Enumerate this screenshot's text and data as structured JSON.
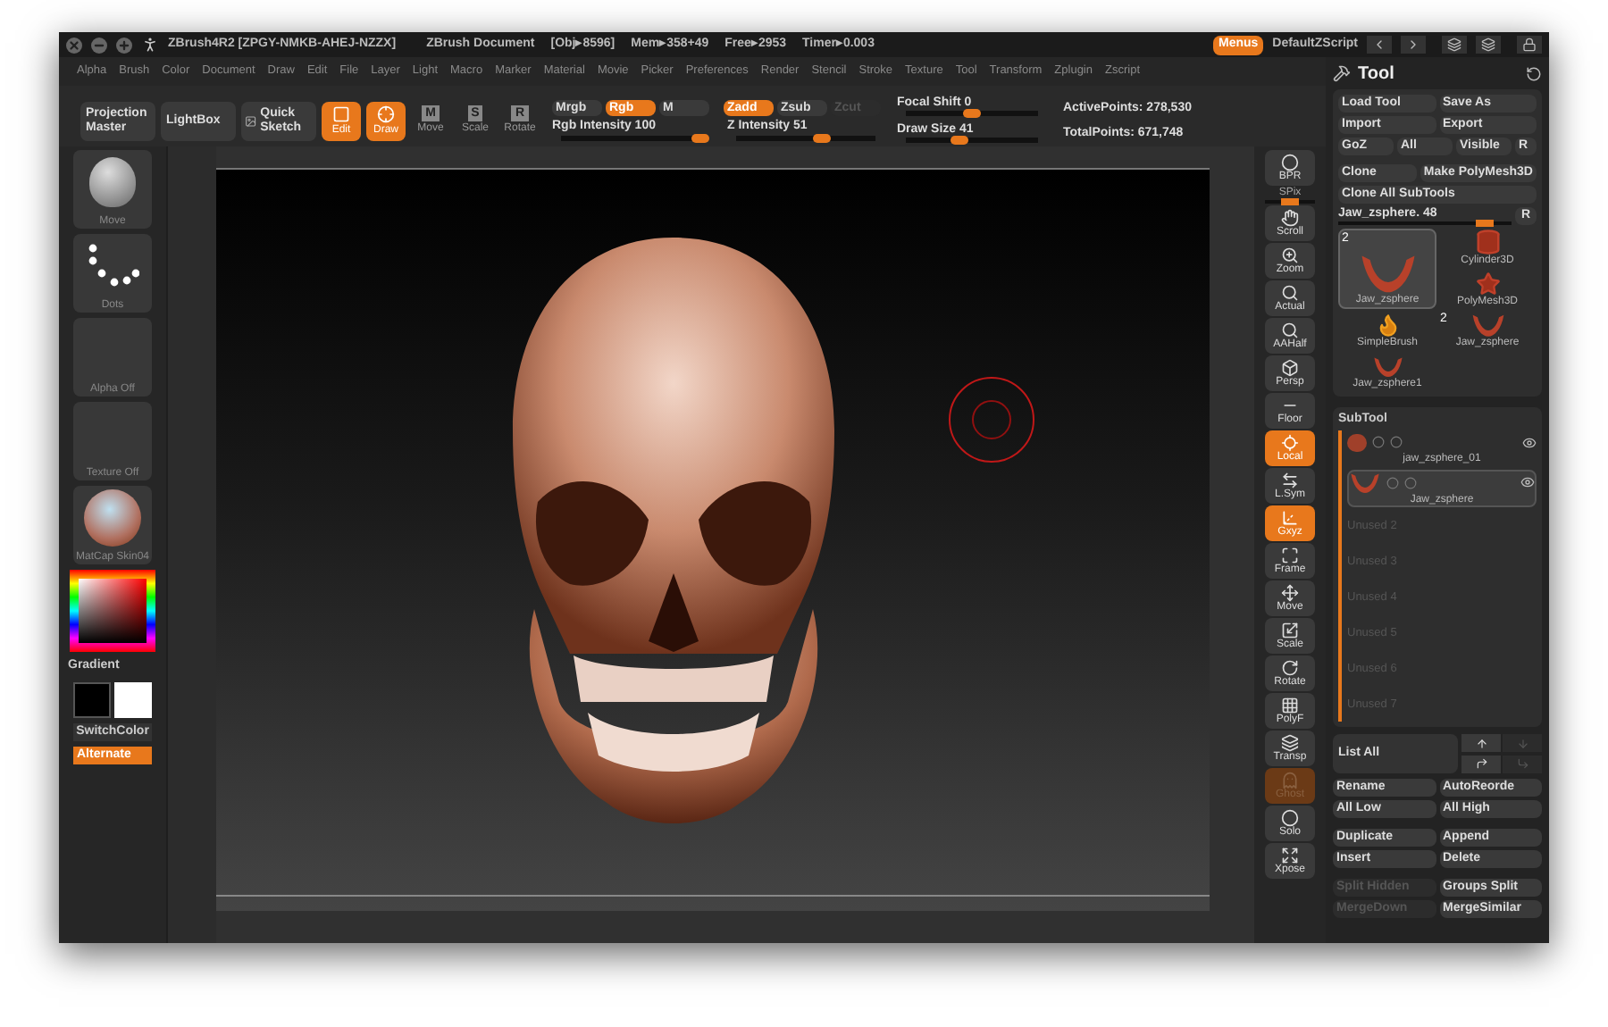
{
  "window": {
    "title": "ZBrush4R2 [ZPGY-NMKB-AHEJ-NZZX]",
    "document": "ZBrush Document",
    "stats": [
      "[Obj▸8596]",
      "Mem▸358+49",
      "Free▸2953",
      "Timer▸0.003"
    ]
  },
  "header_right": {
    "menus": {
      "label": "Menus",
      "on": true
    },
    "script": "DefaultZScript"
  },
  "menu": [
    "Alpha",
    "Brush",
    "Color",
    "Document",
    "Draw",
    "Edit",
    "File",
    "Layer",
    "Light",
    "Macro",
    "Marker",
    "Material",
    "Movie",
    "Picker",
    "Preferences",
    "Render",
    "Stencil",
    "Stroke",
    "Texture",
    "Tool",
    "Transform",
    "Zplugin",
    "Zscript"
  ],
  "toolbar": {
    "projection_master": "Projection Master",
    "lightbox": "LightBox",
    "quick_sketch": "Quick Sketch",
    "modes": [
      {
        "label": "Edit",
        "on": true
      },
      {
        "label": "Draw",
        "on": true
      },
      {
        "label": "Move",
        "key": "M",
        "on": false
      },
      {
        "label": "Scale",
        "key": "S",
        "on": false
      },
      {
        "label": "Rotate",
        "key": "R",
        "on": false
      }
    ],
    "color_modes": [
      {
        "label": "Mrgb",
        "on": false,
        "disabled": false
      },
      {
        "label": "Rgb",
        "on": true,
        "disabled": false
      },
      {
        "label": "M",
        "on": false,
        "disabled": false
      }
    ],
    "z_modes": [
      {
        "label": "Zadd",
        "on": true,
        "disabled": false
      },
      {
        "label": "Zsub",
        "on": false,
        "disabled": false
      },
      {
        "label": "Zcut",
        "on": false,
        "disabled": true
      }
    ],
    "sliders": [
      {
        "label": "Rgb Intensity",
        "value": "100",
        "level": 1.0
      },
      {
        "label": "Z Intensity",
        "value": "51",
        "level": 0.62
      }
    ],
    "right_sliders": [
      {
        "label": "Focal Shift",
        "value": "0",
        "level": 0.5
      },
      {
        "label": "Draw Size",
        "value": "41",
        "level": 0.4
      }
    ],
    "points": [
      "ActivePoints: 278,530",
      "TotalPoints: 671,748"
    ]
  },
  "left_panel": {
    "thumbs": [
      {
        "label": "Move",
        "kind": "brush"
      },
      {
        "label": "Dots",
        "kind": "stroke"
      },
      {
        "label": "Alpha Off",
        "kind": "empty"
      },
      {
        "label": "Texture Off",
        "kind": "empty"
      },
      {
        "label": "MatCap Skin04",
        "kind": "material"
      }
    ],
    "gradient": "Gradient",
    "switch_color": "SwitchColor",
    "alternate": {
      "label": "Alternate",
      "on": true
    }
  },
  "shelf": [
    {
      "label": "BPR",
      "on": false,
      "disabled": false
    },
    {
      "label": "SPix",
      "level": 0.5
    },
    {
      "label": "Scroll",
      "on": false,
      "disabled": false
    },
    {
      "label": "Zoom",
      "on": false,
      "disabled": false
    },
    {
      "label": "Actual",
      "on": false,
      "disabled": false
    },
    {
      "label": "AAHalf",
      "on": false,
      "disabled": false
    },
    {
      "label": "Persp",
      "on": false,
      "disabled": false
    },
    {
      "label": "Floor",
      "on": false,
      "disabled": false
    },
    {
      "label": "Local",
      "on": true,
      "disabled": false
    },
    {
      "label": "L.Sym",
      "on": false,
      "disabled": false
    },
    {
      "label": "Gxyz",
      "on": true,
      "disabled": false
    },
    {
      "label": "Frame",
      "on": false,
      "disabled": false
    },
    {
      "label": "Move",
      "on": false,
      "disabled": false
    },
    {
      "label": "Scale",
      "on": false,
      "disabled": false
    },
    {
      "label": "Rotate",
      "on": false,
      "disabled": false
    },
    {
      "label": "PolyF",
      "on": false,
      "disabled": false
    },
    {
      "label": "Transp",
      "on": false,
      "disabled": false
    },
    {
      "label": "Ghost",
      "on": true,
      "disabled": true
    },
    {
      "label": "Solo",
      "on": false,
      "disabled": false
    },
    {
      "label": "Xpose",
      "on": false,
      "disabled": false
    }
  ],
  "tool": {
    "title": "Tool",
    "button_rows": [
      [
        "Load Tool",
        "Save As"
      ],
      [
        "Import",
        "Export"
      ],
      [
        "GoZ",
        "All",
        "Visible",
        "R"
      ],
      [
        "Clone",
        "Make PolyMesh3D"
      ],
      [
        "Clone All SubTools"
      ]
    ],
    "slider": {
      "label": "Jaw_zsphere. 48",
      "level": 0.85,
      "reset": "R"
    },
    "thumbs": [
      {
        "label": "Jaw_zsphere",
        "badge": "2",
        "kind": "large",
        "selected": true
      },
      {
        "label": "Cylinder3D",
        "kind": "small",
        "selected": false
      },
      {
        "label": "PolyMesh3D",
        "kind": "small",
        "selected": false
      },
      {
        "label": "SimpleBrush",
        "kind": "small",
        "selected": false
      },
      {
        "label": "Jaw_zsphere",
        "badge": "2",
        "kind": "small",
        "selected": false
      },
      {
        "label": "Jaw_zsphere1",
        "kind": "small",
        "selected": false
      }
    ]
  },
  "subtool": {
    "title": "SubTool",
    "items": [
      {
        "name": "jaw_zsphere_01",
        "selected": false
      },
      {
        "name": "Jaw_zsphere",
        "selected": true
      }
    ],
    "unused": [
      "Unused 2",
      "Unused 3",
      "Unused 4",
      "Unused 5",
      "Unused 6",
      "Unused 7"
    ],
    "list_all": "List All",
    "buttons": [
      {
        "label": "Rename",
        "disabled": false
      },
      {
        "label": "AutoReorde",
        "disabled": false
      },
      {
        "label": "All Low",
        "disabled": false
      },
      {
        "label": "All High",
        "disabled": false
      },
      {
        "label": "Duplicate",
        "disabled": false
      },
      {
        "label": "Append",
        "disabled": false
      },
      {
        "label": "Insert",
        "disabled": false
      },
      {
        "label": "Delete",
        "disabled": false
      },
      {
        "label": "Split Hidden",
        "disabled": true
      },
      {
        "label": "Groups Split",
        "disabled": false
      },
      {
        "label": "MergeDown",
        "disabled": true
      },
      {
        "label": "MergeSimilar",
        "disabled": false
      }
    ]
  }
}
